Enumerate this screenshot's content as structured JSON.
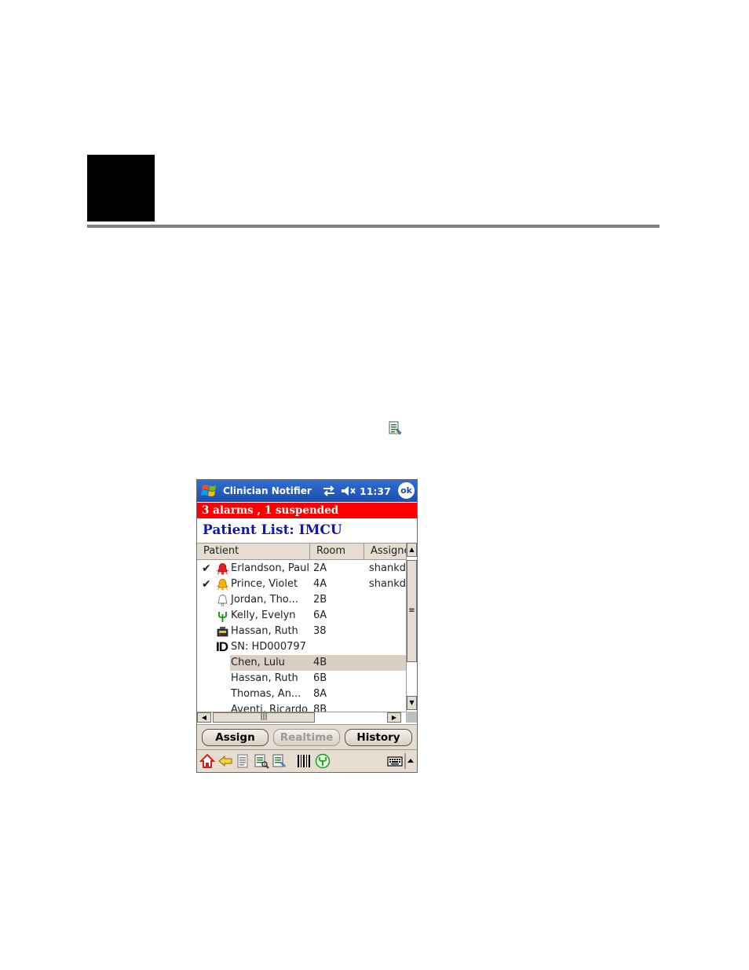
{
  "device": {
    "titlebar": {
      "app_title": "Clinician Notifier",
      "time": "11:37",
      "ok_label": "ok",
      "icons": [
        "windows-start-icon",
        "connectivity-icon",
        "speaker-muted-icon"
      ]
    },
    "alarm_banner": "3 alarms , 1 suspended",
    "list_title": "Patient List: IMCU",
    "columns": [
      "Patient",
      "Room",
      "Assigne"
    ],
    "rows": [
      {
        "check": "✔",
        "icon": "red-bell-icon",
        "patient": "Erlandson, Paul",
        "room": "2A",
        "assigned": "shankd"
      },
      {
        "check": "✔",
        "icon": "yellow-bell-icon",
        "patient": "Prince, Violet",
        "room": "4A",
        "assigned": "shankd"
      },
      {
        "check": "",
        "icon": "outline-bell-icon",
        "patient": "Jordan, Tho...",
        "room": "2B",
        "assigned": ""
      },
      {
        "check": "",
        "icon": "green-lead-icon",
        "patient": "Kelly, Evelyn",
        "room": "6A",
        "assigned": ""
      },
      {
        "check": "",
        "icon": "monitor-device-icon",
        "patient": "Hassan, Ruth",
        "room": "38",
        "assigned": ""
      },
      {
        "check": "",
        "icon": "id-icon",
        "patient": "SN: HD000797",
        "room": "",
        "assigned": ""
      },
      {
        "check": "",
        "icon": "",
        "patient": "Chen, Lulu",
        "room": "4B",
        "assigned": "",
        "selected": true
      },
      {
        "check": "",
        "icon": "",
        "patient": "Hassan, Ruth",
        "room": "6B",
        "assigned": ""
      },
      {
        "check": "",
        "icon": "",
        "patient": "Thomas, An...",
        "room": "8A",
        "assigned": ""
      },
      {
        "check": "",
        "icon": "",
        "patient": "Aventi, Ricardo",
        "room": "8B",
        "assigned": ""
      }
    ],
    "id_glyph": "ID",
    "buttons": {
      "assign": "Assign",
      "realtime": "Realtime",
      "history": "History"
    },
    "toolbar_icons": [
      "home-icon",
      "back-arrow-icon",
      "list-icon",
      "list-search-icon",
      "list-edit-icon",
      "barcode-icon",
      "green-lead-circle-icon",
      "keyboard-icon",
      "menu-up-arrow-icon"
    ],
    "colors": {
      "alarm_red": "#ff0000",
      "title_blue": "#1414b4",
      "titlebar_blue": "#1d4fae",
      "chrome_beige": "#e5ddd0",
      "selected_row": "#d9cfc2"
    }
  }
}
